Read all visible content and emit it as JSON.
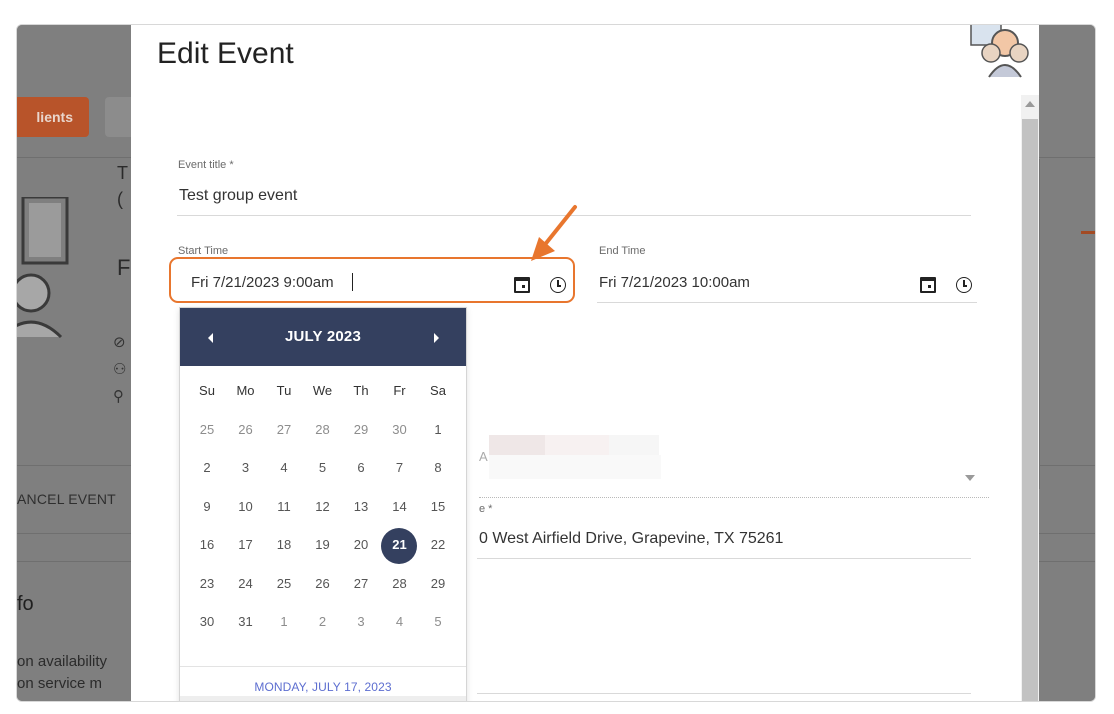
{
  "background": {
    "clients_button": "lients",
    "clipped_title_letter": "T",
    "clipped_paren": "(",
    "clipped_letter": "F",
    "cancel_event": "ANCEL EVENT",
    "info_heading": "fo",
    "availability_line1": "on availability",
    "availability_line2": "on service m"
  },
  "modal": {
    "title": "Edit Event",
    "event_title_label": "Event title *",
    "event_title_value": "Test group event",
    "start_time_label": "Start Time",
    "start_time_value": "Fri 7/21/2023 9:00am",
    "end_time_label": "End Time",
    "end_time_value": "Fri 7/21/2023 10:00am",
    "partial_label_a": "A",
    "address_label": "e *",
    "address_value": "0 West Airfield Drive, Grapevine, TX 75261"
  },
  "datepicker": {
    "month_label": "JULY 2023",
    "weekdays": [
      "Su",
      "Mo",
      "Tu",
      "We",
      "Th",
      "Fr",
      "Sa"
    ],
    "weeks": [
      [
        "25",
        "26",
        "27",
        "28",
        "29",
        "30",
        "1"
      ],
      [
        "2",
        "3",
        "4",
        "5",
        "6",
        "7",
        "8"
      ],
      [
        "9",
        "10",
        "11",
        "12",
        "13",
        "14",
        "15"
      ],
      [
        "16",
        "17",
        "18",
        "19",
        "20",
        "21",
        "22"
      ],
      [
        "23",
        "24",
        "25",
        "26",
        "27",
        "28",
        "29"
      ],
      [
        "30",
        "31",
        "1",
        "2",
        "3",
        "4",
        "5"
      ]
    ],
    "selected_day": "21",
    "footer_text": "MONDAY, JULY 17, 2023"
  },
  "icons": {
    "calendar": "calendar-icon",
    "clock": "clock-icon",
    "prev": "chevron-left-icon",
    "next": "chevron-right-icon",
    "dropdown": "chevron-down-icon"
  },
  "colors": {
    "accent_orange": "#e8762e",
    "datepicker_header": "#34405f",
    "footer_link": "#5d6ed0"
  }
}
